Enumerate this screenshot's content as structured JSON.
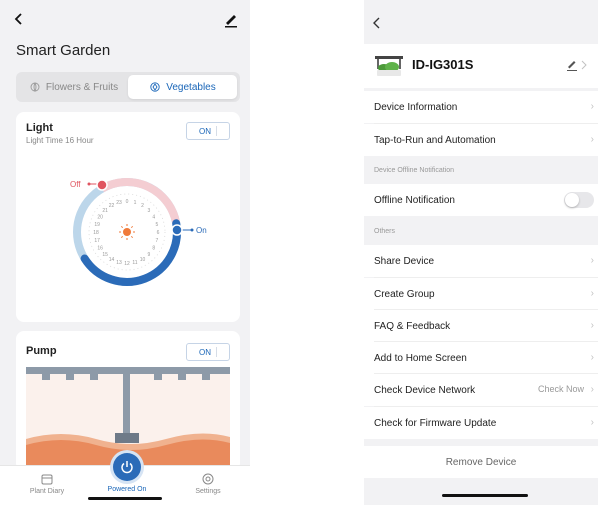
{
  "left": {
    "title": "Smart Garden",
    "tabs": [
      {
        "label": "Flowers & Fruits",
        "icon": "flower-icon",
        "selected": false
      },
      {
        "label": "Vegetables",
        "icon": "vegetable-icon",
        "selected": true
      }
    ],
    "light": {
      "title": "Light",
      "subtitle": "Light Time 16 Hour",
      "toggle": "ON",
      "off_label": "Off",
      "on_label": "On",
      "hours": [
        "22",
        "23",
        "0",
        "1",
        "2",
        "3",
        "4",
        "5",
        "6",
        "7",
        "8",
        "9",
        "10",
        "11",
        "12",
        "13",
        "14",
        "15",
        "16",
        "17",
        "18",
        "19",
        "20",
        "21"
      ]
    },
    "pump": {
      "title": "Pump",
      "toggle": "ON"
    },
    "nav": {
      "diary": "Plant Diary",
      "power": "Powered On",
      "settings": "Settings"
    },
    "colors": {
      "accent": "#1a66b8",
      "off_marker": "#e05560",
      "arc_on": "#2b6bb8",
      "arc_light": "#bcd6ea",
      "arc_pink": "#f4cdd2"
    }
  },
  "right": {
    "device_name": "ID-IG301S",
    "rows": {
      "device_info": "Device Information",
      "tap_to_run": "Tap-to-Run and Automation",
      "offline_section": "Device Offline Notification",
      "offline_notification": "Offline Notification",
      "others_section": "Others",
      "share": "Share Device",
      "create_group": "Create Group",
      "faq": "FAQ & Feedback",
      "add_home": "Add to Home Screen",
      "check_network": "Check Device Network",
      "check_now": "Check Now",
      "firmware": "Check for Firmware Update"
    },
    "remove": "Remove Device",
    "offline_notification_enabled": false
  }
}
